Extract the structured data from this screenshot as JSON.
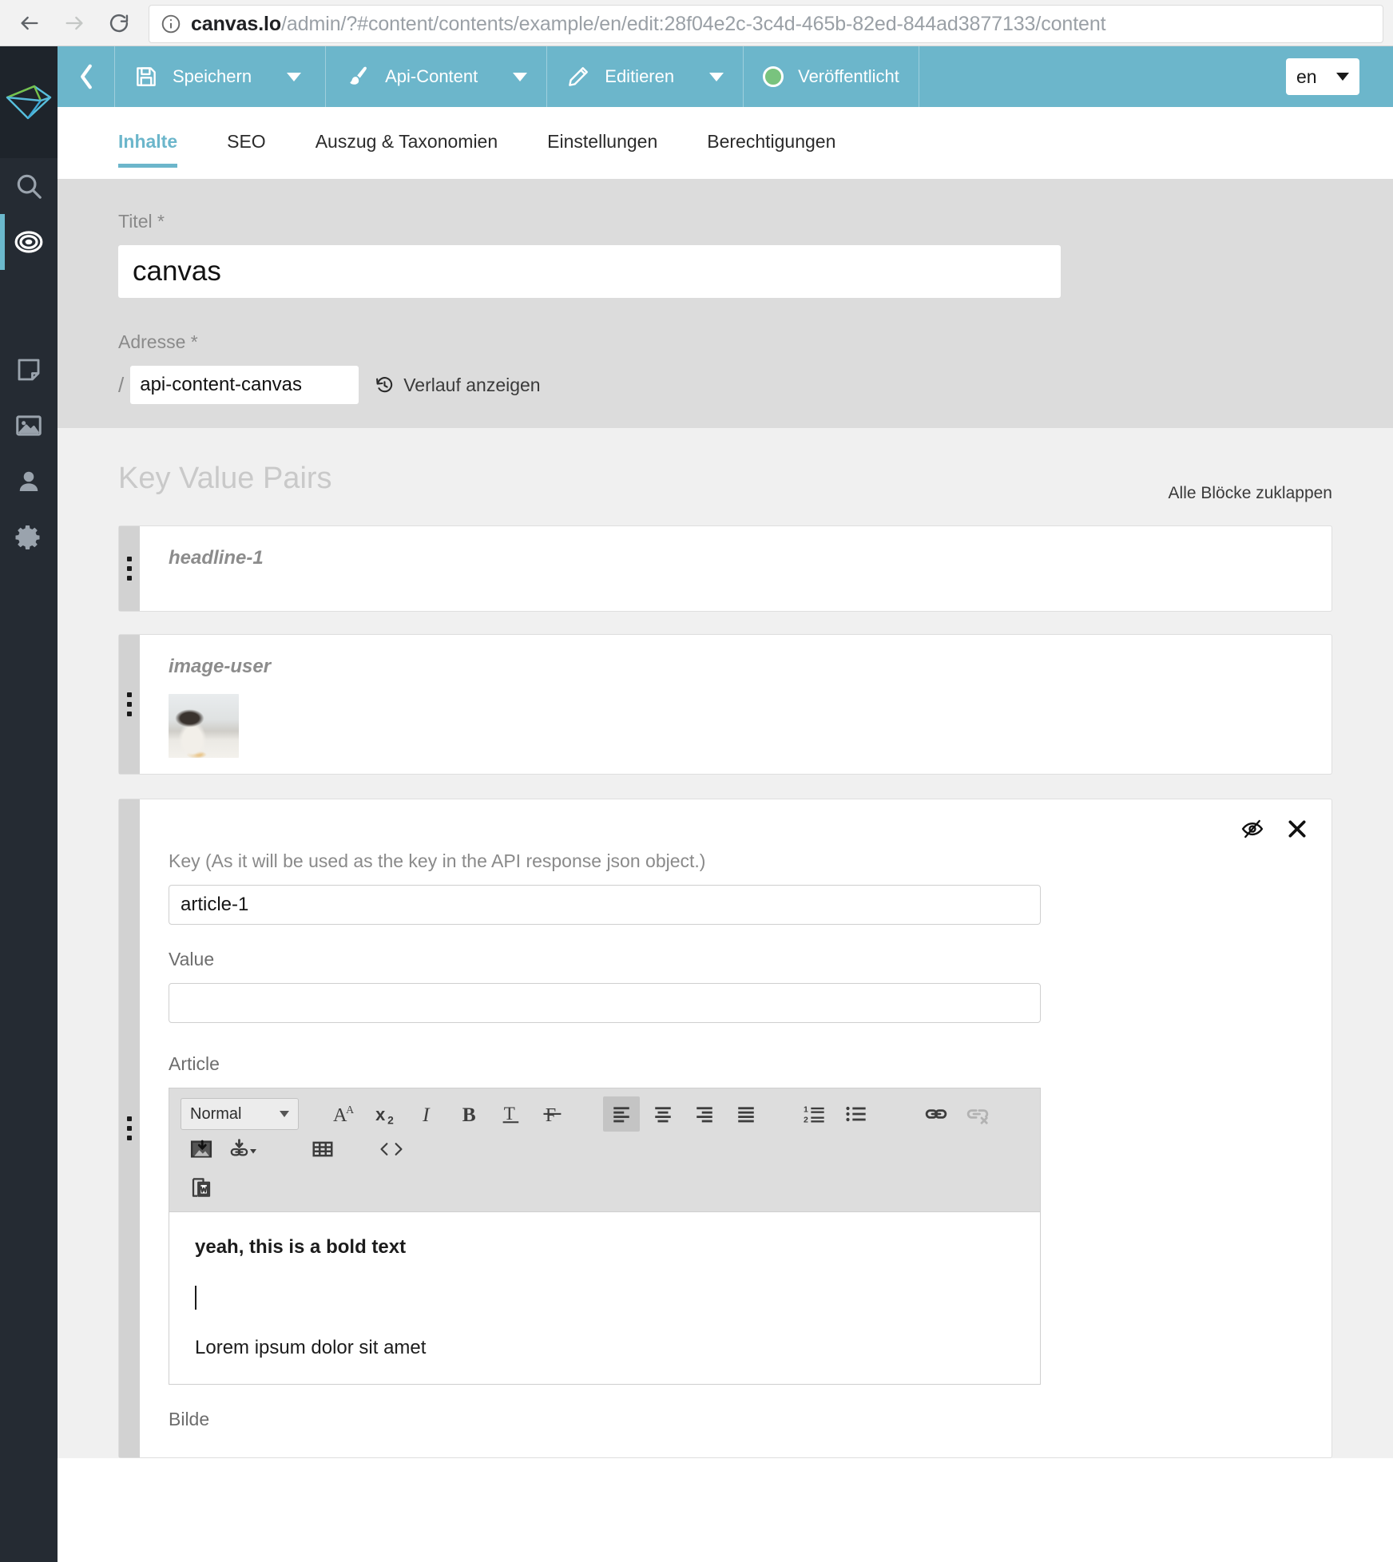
{
  "browser": {
    "back_icon": "arrow-left-icon",
    "forward_icon": "arrow-right-icon",
    "reload_icon": "reload-icon",
    "info_icon": "info-circle-icon",
    "url_host": "canvas.lo",
    "url_path": "/admin/?#content/contents/example/en/edit:28f04e2c-3c4d-465b-82ed-844ad3877133/content"
  },
  "rail": {
    "logo_name": "canvas-logo",
    "items": [
      {
        "name": "search-icon",
        "label": "Suche"
      },
      {
        "name": "content-target-icon",
        "label": "Inhalte"
      },
      {
        "name": "page-icon",
        "label": "Seiten"
      },
      {
        "name": "image-icon",
        "label": "Medien"
      },
      {
        "name": "user-icon",
        "label": "Benutzer"
      },
      {
        "name": "gear-icon",
        "label": "Einstellungen"
      }
    ]
  },
  "toolbar": {
    "back_label": "Zurück",
    "save_label": "Speichern",
    "save_icon": "floppy-disk-icon",
    "type_label": "Api-Content",
    "type_icon": "paintbrush-icon",
    "edit_label": "Editieren",
    "edit_icon": "pencil-icon",
    "status_label": "Veröffentlicht",
    "status_icon": "status-dot-icon",
    "status_color": "#79c37e",
    "language_value": "en",
    "accent_color": "#6cb6cb"
  },
  "tabs": [
    {
      "label": "Inhalte",
      "active": true
    },
    {
      "label": "SEO",
      "active": false
    },
    {
      "label": "Auszug & Taxonomien",
      "active": false
    },
    {
      "label": "Einstellungen",
      "active": false
    },
    {
      "label": "Berechtigungen",
      "active": false
    }
  ],
  "form": {
    "title_label": "Titel *",
    "title_value": "canvas",
    "title_placeholder": "",
    "address_label": "Adresse *",
    "address_prefix": "/",
    "address_value": "api-content-canvas",
    "history_label": "Verlauf anzeigen",
    "history_icon": "history-icon"
  },
  "kvp": {
    "section_title": "Key Value Pairs",
    "collapse_all_label": "Alle Blöcke zuklappen",
    "blocks": [
      {
        "key_display": "headline-1",
        "type": "collapsed"
      },
      {
        "key_display": "image-user",
        "type": "collapsed-image"
      }
    ],
    "expanded_block": {
      "hide_icon": "eye-slash-icon",
      "close_icon": "close-icon",
      "key_label": "Key (As it will be used as the key in the API response json object.)",
      "key_value": "article-1",
      "value_label": "Value",
      "value_value": "",
      "article_label": "Article",
      "trailing_label": "Bilde",
      "editor": {
        "format_value": "Normal",
        "buttons": [
          {
            "name": "font-size-icon",
            "glyph": "A",
            "state": "normal"
          },
          {
            "name": "subscript-icon",
            "glyph": "x",
            "state": "normal"
          },
          {
            "name": "italic-icon",
            "glyph": "I",
            "state": "normal"
          },
          {
            "name": "bold-icon",
            "glyph": "B",
            "state": "normal"
          },
          {
            "name": "underline-icon",
            "glyph": "T",
            "state": "normal"
          },
          {
            "name": "strikethrough-icon",
            "glyph": "F",
            "state": "normal"
          },
          {
            "name": "align-left-icon",
            "glyph": "",
            "state": "active"
          },
          {
            "name": "align-center-icon",
            "glyph": "",
            "state": "normal"
          },
          {
            "name": "align-right-icon",
            "glyph": "",
            "state": "normal"
          },
          {
            "name": "align-justify-icon",
            "glyph": "",
            "state": "normal"
          },
          {
            "name": "ordered-list-icon",
            "glyph": "",
            "state": "normal"
          },
          {
            "name": "unordered-list-icon",
            "glyph": "",
            "state": "normal"
          },
          {
            "name": "insert-link-icon",
            "glyph": "",
            "state": "normal"
          },
          {
            "name": "remove-link-icon",
            "glyph": "",
            "state": "disabled"
          },
          {
            "name": "insert-image-icon",
            "glyph": "",
            "state": "normal"
          },
          {
            "name": "insert-file-link-icon",
            "glyph": "",
            "state": "normal"
          },
          {
            "name": "insert-table-icon",
            "glyph": "",
            "state": "normal"
          },
          {
            "name": "source-code-icon",
            "glyph": "< >",
            "state": "normal"
          },
          {
            "name": "paste-from-word-icon",
            "glyph": "",
            "state": "normal"
          }
        ],
        "content": {
          "line1": "yeah, this is a bold text",
          "line2": "",
          "line3": "Lorem ipsum dolor sit amet"
        }
      }
    }
  }
}
